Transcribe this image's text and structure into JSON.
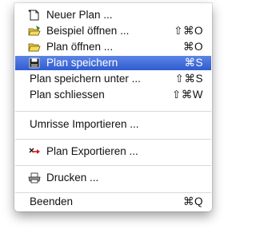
{
  "menu": {
    "items": [
      {
        "label": "Neuer Plan ...",
        "shortcut": "",
        "icon": "new-document-icon"
      },
      {
        "label": "Beispiel öffnen ...",
        "shortcut": "⇧⌘O",
        "icon": "open-example-folder-icon"
      },
      {
        "label": "Plan öffnen ...",
        "shortcut": "⌘O",
        "icon": "open-folder-icon"
      },
      {
        "label": "Plan speichern",
        "shortcut": "⌘S",
        "icon": "floppy-disk-icon",
        "selected": true
      },
      {
        "label": "Plan speichern unter ...",
        "shortcut": "⇧⌘S"
      },
      {
        "label": "Plan schliessen",
        "shortcut": "⇧⌘W"
      },
      {
        "label": "Umrisse Importieren ..."
      },
      {
        "label": "Plan Exportieren ...",
        "icon": "export-arrow-icon"
      },
      {
        "label": "Drucken ...",
        "icon": "printer-icon"
      },
      {
        "label": "Beenden",
        "shortcut": "⌘Q"
      }
    ]
  },
  "colors": {
    "selection": "#3d6bd8",
    "separator": "#d8d8d8",
    "text": "#111111"
  }
}
